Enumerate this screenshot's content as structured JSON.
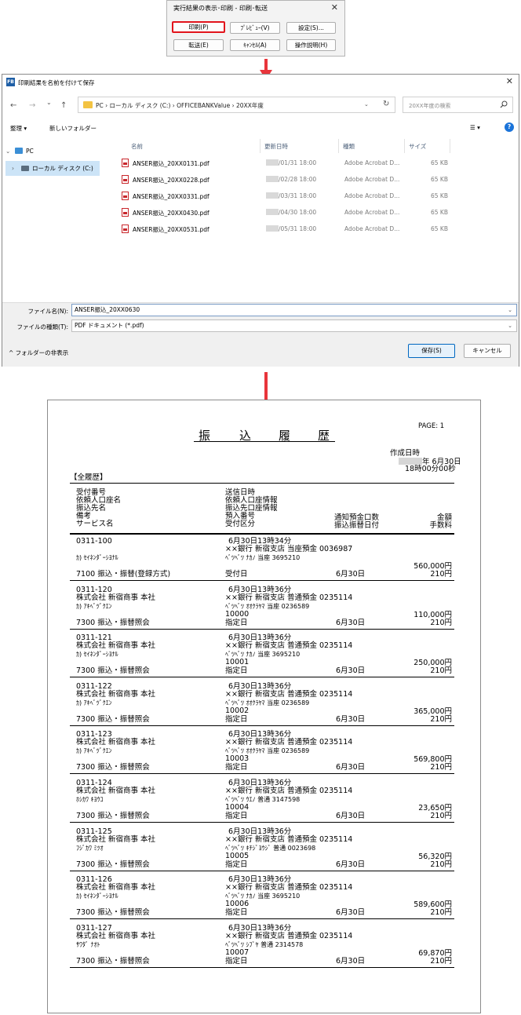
{
  "dialog1": {
    "title": "実行結果の表示･印刷 - 印刷･転送",
    "close": "✕",
    "buttons": [
      "印刷(P)",
      "ﾌﾟﾚﾋﾞｭｰ(V)",
      "設定(S)...",
      "転送(E)",
      "ｷｬﾝｾﾙ(A)",
      "操作説明(H)"
    ],
    "highlighted_button": "印刷(P)"
  },
  "dialog2": {
    "title": "印刷結果を名前を付けて保存",
    "app_icon": "FB",
    "close": "✕",
    "nav": {
      "back": "←",
      "forward": "→",
      "recent": "⌄",
      "up": "↑"
    },
    "breadcrumb": "PC  ›  ローカル ディスク (C:)  ›  OFFICEBANKValue  ›  20XX年度",
    "refresh": "↻",
    "search_placeholder": "20XX年度の検索",
    "toolbar": {
      "organize": "整理 ▾",
      "new_folder": "新しいフォルダー",
      "view": "☰ ▾",
      "help": "?"
    },
    "tree": [
      {
        "label": "PC",
        "expander": "⌄"
      },
      {
        "label": "ローカル ディスク (C:)",
        "expander": "›"
      }
    ],
    "columns": [
      "名前",
      "更新日時",
      "種類",
      "サイズ"
    ],
    "files": [
      {
        "name": "ANSER振込_20XX0131.pdf",
        "date": "/01/31 18:00",
        "type": "Adobe Acrobat D...",
        "size": "65 KB"
      },
      {
        "name": "ANSER振込_20XX0228.pdf",
        "date": "/02/28 18:00",
        "type": "Adobe Acrobat D...",
        "size": "65 KB"
      },
      {
        "name": "ANSER振込_20XX0331.pdf",
        "date": "/03/31 18:00",
        "type": "Adobe Acrobat D...",
        "size": "65 KB"
      },
      {
        "name": "ANSER振込_20XX0430.pdf",
        "date": "/04/30 18:00",
        "type": "Adobe Acrobat D...",
        "size": "65 KB"
      },
      {
        "name": "ANSER振込_20XX0531.pdf",
        "date": "/05/31 18:00",
        "type": "Adobe Acrobat D...",
        "size": "65 KB"
      }
    ],
    "filename_label": "ファイル名(N):",
    "filename_value": "ANSER振込_20XX0630",
    "filetype_label": "ファイルの種類(T):",
    "filetype_value": "PDF ドキュメント (*.pdf)",
    "hide_folders": "^  フォルダーの非表示",
    "save": "保存(S)",
    "cancel": "キャンセル"
  },
  "report": {
    "page": "PAGE:   1",
    "title_chars": [
      "振",
      "込",
      "履",
      "歴"
    ],
    "created_label": "作成日時",
    "created_date": "年  6月30日",
    "created_time": "18時00分00秒",
    "section": "【全履歴】",
    "headers": {
      "col1": [
        "受付番号",
        "依頼人口座名",
        "振込先名",
        "備考",
        "サービス名"
      ],
      "col2": [
        "送信日時",
        "依頼人口座情報",
        "振込先口座情報",
        "預入番号",
        "受付区分"
      ],
      "col3": [
        "通知預金口数",
        "振込振替日付"
      ],
      "col4": [
        "金額",
        "手数料"
      ]
    },
    "records": [
      {
        "id": "0311-100",
        "requester": "",
        "payee": "ｶ) ｾｲﾈﾝﾀﾞｰｼﾖﾅﾙ",
        "service": "7100 振込・振替(登録方式)",
        "sent": "6月30日13時34分",
        "req_acct": "××銀行 新宿支店 当座預金 0036987",
        "payee_acct": "ﾍﾞﾂﾍﾞﾂ ﾅｶﾉ 当座 3695210",
        "deposit_no": "",
        "kubun": "受付日",
        "date": "6月30日",
        "amount": "560,000円",
        "fee": "210円"
      },
      {
        "id": "0311-120",
        "requester": "株式会社 新宿商事 本社",
        "payee": "ｶ) ｱｷﾍﾞﾂﾞｸｴﾝ",
        "service": "7300 振込・振替照会",
        "sent": "6月30日13時36分",
        "req_acct": "××銀行 新宿支店 普通預金 0235114",
        "payee_acct": "ﾍﾞﾂﾍﾞﾂ ｵｵｸﾗﾔﾏ 当座 0236589",
        "deposit_no": "10000",
        "kubun": "指定日",
        "date": "6月30日",
        "amount": "110,000円",
        "fee": "210円"
      },
      {
        "id": "0311-121",
        "requester": "株式会社 新宿商事 本社",
        "payee": "ｶ) ｾｲﾈﾝﾀﾞｰｼﾖﾅﾙ",
        "service": "7300 振込・振替照会",
        "sent": "6月30日13時36分",
        "req_acct": "××銀行 新宿支店 普通預金 0235114",
        "payee_acct": "ﾍﾞﾂﾍﾞﾂ ﾅｶﾉ 当座 3695210",
        "deposit_no": "10001",
        "kubun": "指定日",
        "date": "6月30日",
        "amount": "250,000円",
        "fee": "210円"
      },
      {
        "id": "0311-122",
        "requester": "株式会社 新宿商事 本社",
        "payee": "ｶ) ｱｷﾍﾞﾂﾞｸｴﾝ",
        "service": "7300 振込・振替照会",
        "sent": "6月30日13時36分",
        "req_acct": "××銀行 新宿支店 普通預金 0235114",
        "payee_acct": "ﾍﾞﾂﾍﾞﾂ ｵｵｸﾗﾔﾏ 当座 0236589",
        "deposit_no": "10002",
        "kubun": "指定日",
        "date": "6月30日",
        "amount": "365,000円",
        "fee": "210円"
      },
      {
        "id": "0311-123",
        "requester": "株式会社 新宿商事 本社",
        "payee": "ｶ) ｱｷﾍﾞﾂﾞｸｴﾝ",
        "service": "7300 振込・振替照会",
        "sent": "6月30日13時36分",
        "req_acct": "××銀行 新宿支店 普通預金 0235114",
        "payee_acct": "ﾍﾞﾂﾍﾞﾂ ｵｵｸﾗﾔﾏ 当座 0236589",
        "deposit_no": "10003",
        "kubun": "指定日",
        "date": "6月30日",
        "amount": "569,800円",
        "fee": "210円"
      },
      {
        "id": "0311-124",
        "requester": "株式会社 新宿商事 本社",
        "payee": "ﾎｼｶﾜ ｷﾖｳｺ",
        "service": "7300 振込・振替照会",
        "sent": "6月30日13時36分",
        "req_acct": "××銀行 新宿支店 普通預金 0235114",
        "payee_acct": "ﾍﾞﾂﾍﾞﾂ ｳｴﾉ 普通 3147598",
        "deposit_no": "10004",
        "kubun": "指定日",
        "date": "6月30日",
        "amount": "23,650円",
        "fee": "210円"
      },
      {
        "id": "0311-125",
        "requester": "株式会社 新宿商事 本社",
        "payee": "ﾌｼﾞｶﾜ ﾐﾂｵ",
        "service": "7300 振込・振替照会",
        "sent": "6月30日13時36分",
        "req_acct": "××銀行 新宿支店 普通預金 0235114",
        "payee_acct": "ﾍﾞﾂﾍﾞﾂ ｷﾁｼﾞﾖｳｼﾞ 普通 0023698",
        "deposit_no": "10005",
        "kubun": "指定日",
        "date": "6月30日",
        "amount": "56,320円",
        "fee": "210円"
      },
      {
        "id": "0311-126",
        "requester": "株式会社 新宿商事 本社",
        "payee": "ｶ) ｾｲﾈﾝﾀﾞｰｼﾖﾅﾙ",
        "service": "7300 振込・振替照会",
        "sent": "6月30日13時36分",
        "req_acct": "××銀行 新宿支店 普通預金 0235114",
        "payee_acct": "ﾍﾞﾂﾍﾞﾂ ﾅｶﾉ 当座 3695210",
        "deposit_no": "10006",
        "kubun": "指定日",
        "date": "6月30日",
        "amount": "589,600円",
        "fee": "210円"
      },
      {
        "id": "0311-127",
        "requester": "株式会社 新宿商事 本社",
        "payee": "ｻﾜﾀﾞ ﾅｵﾄ",
        "service": "7300 振込・振替照会",
        "sent": "6月30日13時36分",
        "req_acct": "××銀行 新宿支店 普通預金 0235114",
        "payee_acct": "ﾍﾞﾂﾍﾞﾂ ｼﾌﾞﾔ 普通 2314578",
        "deposit_no": "10007",
        "kubun": "指定日",
        "date": "6月30日",
        "amount": "69,870円",
        "fee": "210円"
      }
    ]
  }
}
